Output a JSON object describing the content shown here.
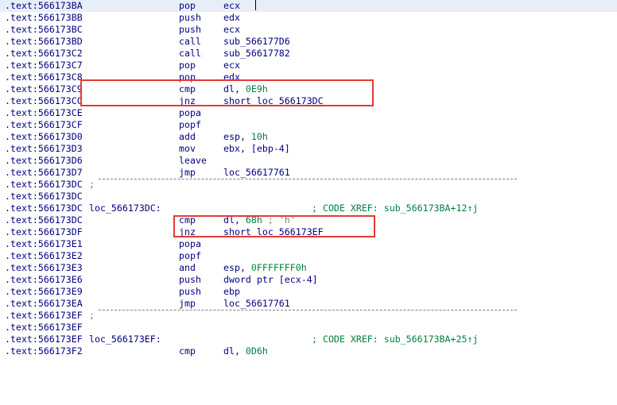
{
  "lines": [
    {
      "addr": ".text:566173BA",
      "mnem": "pop",
      "ops": "ecx",
      "highlight": true
    },
    {
      "addr": ".text:566173BB",
      "mnem": "push",
      "ops": "edx"
    },
    {
      "addr": ".text:566173BC",
      "mnem": "push",
      "ops": "ecx"
    },
    {
      "addr": ".text:566173BD",
      "mnem": "call",
      "ops": "sub_566177D6"
    },
    {
      "addr": ".text:566173C2",
      "mnem": "call",
      "ops": "sub_56617782"
    },
    {
      "addr": ".text:566173C7",
      "mnem": "pop",
      "ops": "ecx"
    },
    {
      "addr": ".text:566173C8",
      "mnem": "pop",
      "ops": "edx"
    },
    {
      "addr": ".text:566173C9",
      "mnem": "cmp",
      "ops": "dl, ",
      "imm": "0E9h"
    },
    {
      "addr": ".text:566173CC",
      "mnem": "jnz",
      "ops": "short loc_566173DC"
    },
    {
      "addr": ".text:566173CE",
      "mnem": "popa"
    },
    {
      "addr": ".text:566173CF",
      "mnem": "popf"
    },
    {
      "addr": ".text:566173D0",
      "mnem": "add",
      "ops": "esp, ",
      "imm": "10h"
    },
    {
      "addr": ".text:566173D3",
      "mnem": "mov",
      "ops": "ebx, [ebp-4]"
    },
    {
      "addr": ".text:566173D6",
      "mnem": "leave"
    },
    {
      "addr": ".text:566173D7",
      "mnem": "jmp",
      "ops": "loc_56617761"
    },
    {
      "addr": ".text:566173DC",
      "label": ";",
      "separator": true
    },
    {
      "addr": ".text:566173DC"
    },
    {
      "addr": ".text:566173DC",
      "label": "loc_566173DC:",
      "xref": "; CODE XREF: sub_566173BA+12↑j"
    },
    {
      "addr": ".text:566173DC",
      "mnem": "cmp",
      "ops": "dl, ",
      "imm": "68h",
      "comment": " ; 'h'"
    },
    {
      "addr": ".text:566173DF",
      "mnem": "jnz",
      "ops": "short loc_566173EF"
    },
    {
      "addr": ".text:566173E1",
      "mnem": "popa"
    },
    {
      "addr": ".text:566173E2",
      "mnem": "popf"
    },
    {
      "addr": ".text:566173E3",
      "mnem": "and",
      "ops": "esp, ",
      "imm": "0FFFFFFF0h"
    },
    {
      "addr": ".text:566173E6",
      "mnem": "push",
      "ops": "dword ptr [ecx-4]"
    },
    {
      "addr": ".text:566173E9",
      "mnem": "push",
      "ops": "ebp"
    },
    {
      "addr": ".text:566173EA",
      "mnem": "jmp",
      "ops": "loc_56617761"
    },
    {
      "addr": ".text:566173EF",
      "label": ";",
      "separator": true
    },
    {
      "addr": ".text:566173EF"
    },
    {
      "addr": ".text:566173EF",
      "label": "loc_566173EF:",
      "xref": "; CODE XREF: sub_566173BA+25↑j"
    },
    {
      "addr": ".text:566173F2",
      "mnem": "cmp",
      "ops": "dl, ",
      "imm": "0D6h"
    }
  ],
  "colors": {
    "highlight_row": "#e8eef7",
    "box": "#e53935",
    "text": "#000080",
    "immediate": "#008040"
  }
}
